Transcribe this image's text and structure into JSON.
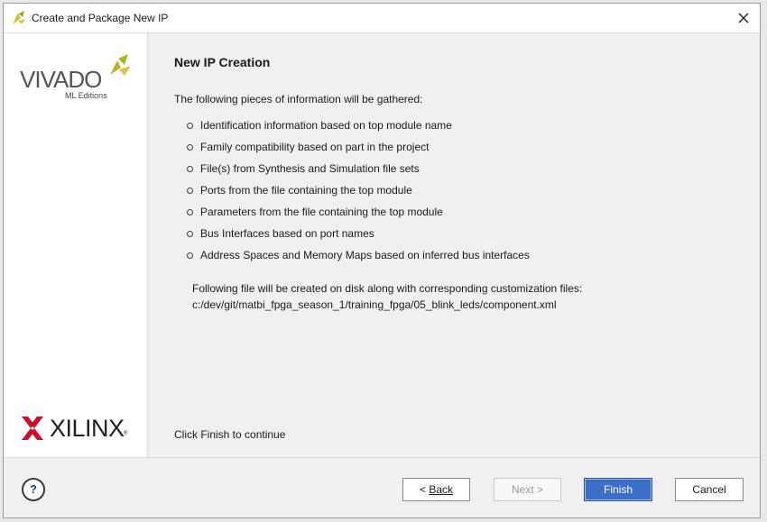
{
  "window": {
    "title": "Create and Package New IP"
  },
  "branding": {
    "vivado_text": "VIVADO",
    "vivado_subtitle": "ML Editions",
    "xilinx_text": "XILINX",
    "xilinx_registered": "®"
  },
  "page": {
    "heading": "New IP Creation",
    "intro": "The following pieces of information will be gathered:",
    "items": [
      "Identification information based on top module name",
      "Family compatibility based on part in the project",
      "File(s) from Synthesis and Simulation file sets",
      "Ports from the file containing the top module",
      "Parameters from the file containing the top module",
      "Bus Interfaces based on port names",
      "Address Spaces and Memory Maps based on inferred bus interfaces"
    ],
    "file_note": "Following file will be created on disk along with corresponding customization files:",
    "file_path": "c:/dev/git/matbi_fpga_season_1/training_fpga/05_blink_leds/component.xml",
    "finish_hint": "Click Finish to continue"
  },
  "footer": {
    "help_label": "?",
    "back_prefix": "< ",
    "back_label": "Back",
    "next_label": "Next >",
    "finish_label": "Finish",
    "cancel_label": "Cancel"
  },
  "colors": {
    "accent": "#3b6fc6",
    "vivado_mark": "#a8b820",
    "xilinx_mark": "#c8102e"
  }
}
